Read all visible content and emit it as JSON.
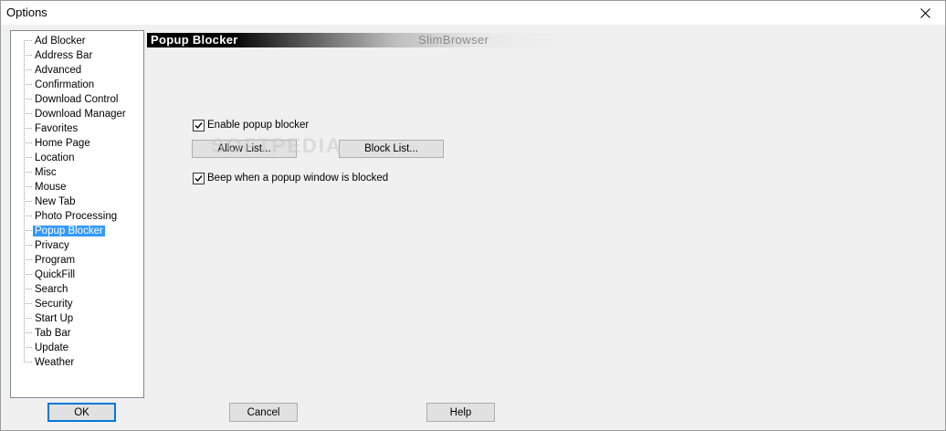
{
  "window": {
    "title": "Options",
    "close_icon": "close-icon"
  },
  "tree": {
    "items": [
      {
        "label": "Ad Blocker"
      },
      {
        "label": "Address Bar"
      },
      {
        "label": "Advanced"
      },
      {
        "label": "Confirmation"
      },
      {
        "label": "Download Control"
      },
      {
        "label": "Download Manager"
      },
      {
        "label": "Favorites"
      },
      {
        "label": "Home Page"
      },
      {
        "label": "Location"
      },
      {
        "label": "Misc"
      },
      {
        "label": "Mouse"
      },
      {
        "label": "New Tab"
      },
      {
        "label": "Photo Processing"
      },
      {
        "label": "Popup Blocker",
        "selected": true
      },
      {
        "label": "Privacy"
      },
      {
        "label": "Program"
      },
      {
        "label": "QuickFill"
      },
      {
        "label": "Search"
      },
      {
        "label": "Security"
      },
      {
        "label": "Start Up"
      },
      {
        "label": "Tab Bar"
      },
      {
        "label": "Update"
      },
      {
        "label": "Weather"
      }
    ]
  },
  "panel": {
    "title": "Popup Blocker",
    "brand": "SlimBrowser",
    "enable_label": "Enable popup blocker",
    "enable_checked": true,
    "allow_list_label": "Allow List...",
    "block_list_label": "Block List...",
    "beep_label": "Beep when a popup window is blocked",
    "beep_checked": true
  },
  "watermark": "SOFTPEDIA",
  "footer": {
    "ok_label": "OK",
    "cancel_label": "Cancel",
    "help_label": "Help"
  },
  "colors": {
    "selection": "#3399ff",
    "default_button_border": "#0078d7"
  }
}
